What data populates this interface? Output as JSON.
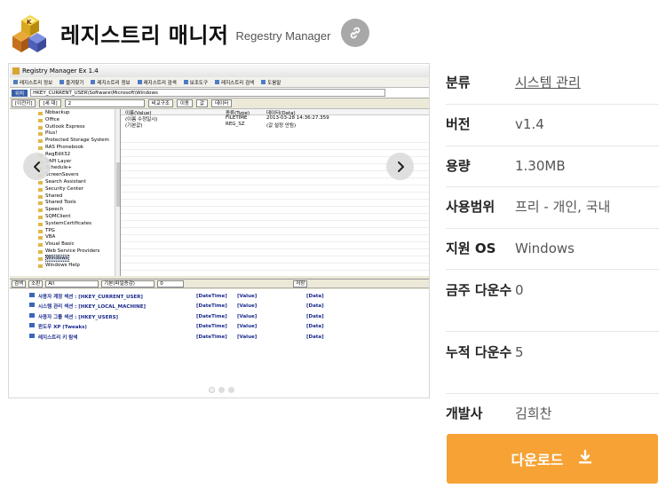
{
  "header": {
    "title": "레지스트리 매니저",
    "subtitle": "Regestry Manager"
  },
  "screenshot": {
    "window_title": "Registry Manager Ex 1.4",
    "menu": [
      "레지스트리 정보",
      "즐겨찾기",
      "레지스트리 정보",
      "레지스트리 검색",
      "보조도구",
      "레지스트리 검색",
      "도움말"
    ],
    "path_label": "위치",
    "path_value": "HKEY_CURRENT_USER\\Software\\Microsoft\\Windows",
    "tool_items": [
      "[이전키]",
      "[세 대]",
      "2",
      "비교구조",
      "이동",
      "값",
      "데이터"
    ],
    "tree_items": [
      "Nbbackup",
      "Office",
      "Outlook Express",
      "Plus!",
      "Protected Storage System",
      "RAS Phonebook",
      "RegEdit32",
      "SAPI Layer",
      "Schedule+",
      "ScreenSavers",
      "Search Assistant",
      "Security Center",
      "Shared",
      "Shared Tools",
      "Speech",
      "SQMClient",
      "SystemCertificates",
      "TPG",
      "VBA",
      "Visual Basic",
      "Web Service Providers",
      "Windows",
      "Windows Help"
    ],
    "selected_tree_item": "Windows",
    "value_headers": [
      "이름(Value)",
      "종류(Type)",
      "데이터(Data)"
    ],
    "value_rows": [
      [
        "(이름 수정일시)",
        "FILETIME",
        "2013-03-28 14:36:27.359"
      ],
      [
        "(기본값)",
        "REG_SZ",
        "(값 설정 안됨)"
      ]
    ],
    "search_items": [
      "검색",
      "소핀",
      "All",
      "기본(파일증감)",
      "0",
      "저장"
    ],
    "favorites": [
      {
        "name": "사용자 계정 섹션 : [HKEY_CURRENT_USER]",
        "type": "[DateTime]",
        "value": "[Value]",
        "data": "[Data]"
      },
      {
        "name": "시스템 관리 섹션 : [HKEY_LOCAL_MACHINE]",
        "type": "[DateTime]",
        "value": "[Value]",
        "data": "[Data]"
      },
      {
        "name": "사용자 그룹 섹션 : [HKEY_USERS]",
        "type": "[DateTime]",
        "value": "[Value]",
        "data": "[Data]"
      },
      {
        "name": "윈도우 XP (Tweaks)",
        "type": "[DateTime]",
        "value": "[Value]",
        "data": "[Data]"
      },
      {
        "name": "레지스트리 키 탐색",
        "type": "[DateTime]",
        "value": "[Value]",
        "data": "[Data]"
      }
    ]
  },
  "info": {
    "rows": [
      {
        "label": "분류",
        "value": "시스템 관리"
      },
      {
        "label": "버전",
        "value": "v1.4"
      },
      {
        "label": "용량",
        "value": "1.30MB"
      },
      {
        "label": "사용범위",
        "value": "프리 - 개인, 국내"
      },
      {
        "label": "지원 OS",
        "value": "Windows"
      },
      {
        "label": "금주 다운수",
        "value": "0"
      },
      {
        "label": "누적 다운수",
        "value": "5"
      },
      {
        "label": "개발사",
        "value": "김희찬"
      }
    ]
  },
  "download": {
    "label": "다운로드"
  },
  "colors": {
    "accent": "#f6a234",
    "link_btn": "#a8a8a8"
  }
}
